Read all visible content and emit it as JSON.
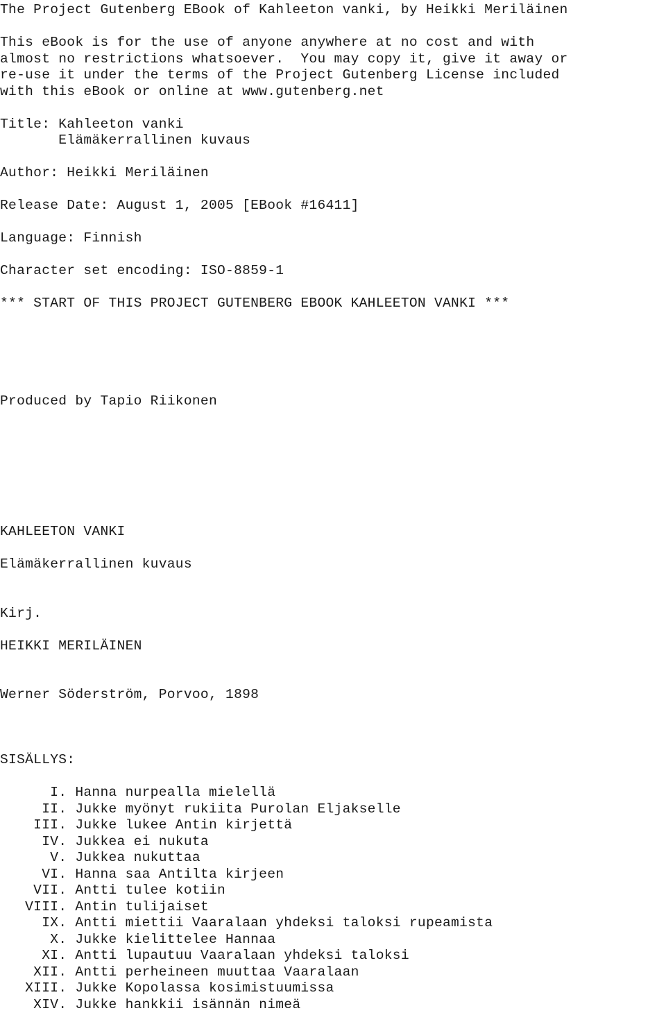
{
  "document": {
    "type": "project-gutenberg-plain-text-ebook",
    "encoding_note": "ISO-8859-1",
    "header": {
      "banner_line": "The Project Gutenberg EBook of Kahleeton vanki, by Heikki Meriläinen",
      "license_paragraph_lines": [
        "This eBook is for the use of anyone anywhere at no cost and with",
        "almost no restrictions whatsoever.  You may copy it, give it away or",
        "re-use it under the terms of the Project Gutenberg License included",
        "with this eBook or online at www.gutenberg.net"
      ]
    },
    "metadata": {
      "title_line": "Title: Kahleeton vanki",
      "title_subline": "       Elämäkerrallinen kuvaus",
      "author_line": "Author: Heikki Meriläinen",
      "release_date_line": "Release Date: August 1, 2005 [EBook #16411]",
      "language_line": "Language: Finnish",
      "charset_line": "Character set encoding: ISO-8859-1"
    },
    "start_marker": "*** START OF THIS PROJECT GUTENBERG EBOOK KAHLEETON VANKI ***",
    "producer_line": "Produced by Tapio Riikonen",
    "title_page": {
      "book_title": "KAHLEETON VANKI",
      "subtitle": "Elämäkerrallinen kuvaus",
      "byline_label": "Kirj.",
      "author_name": "HEIKKI MERILÄINEN",
      "publisher_line": "Werner Söderström, Porvoo, 1898"
    },
    "contents": {
      "heading": "SISÄLLYS:",
      "entries": [
        {
          "numeral": "I.",
          "title": "Hanna nurpealla mielellä"
        },
        {
          "numeral": "II.",
          "title": "Jukke myönyt rukiita Purolan Eljakselle"
        },
        {
          "numeral": "III.",
          "title": "Jukke lukee Antin kirjettä"
        },
        {
          "numeral": "IV.",
          "title": "Jukkea ei nukuta"
        },
        {
          "numeral": "V.",
          "title": "Jukkea nukuttaa"
        },
        {
          "numeral": "VI.",
          "title": "Hanna saa Antilta kirjeen"
        },
        {
          "numeral": "VII.",
          "title": "Antti tulee kotiin"
        },
        {
          "numeral": "VIII.",
          "title": "Antin tulijaiset"
        },
        {
          "numeral": "IX.",
          "title": "Antti miettii Vaaralaan yhdeksi taloksi rupeamista"
        },
        {
          "numeral": "X.",
          "title": "Jukke kielittelee Hannaa"
        },
        {
          "numeral": "XI.",
          "title": "Antti lupautuu Vaaralaan yhdeksi taloksi"
        },
        {
          "numeral": "XII.",
          "title": "Antti perheineen muuttaa Vaaralaan"
        },
        {
          "numeral": "XIII.",
          "title": "Jukke Kopolassa kosimistuumissa"
        },
        {
          "numeral": "XIV.",
          "title": "Jukke hankkii isännän nimeä"
        }
      ]
    }
  },
  "colors": {
    "page_background": "#ffffff",
    "text": "#1a1a1a"
  }
}
